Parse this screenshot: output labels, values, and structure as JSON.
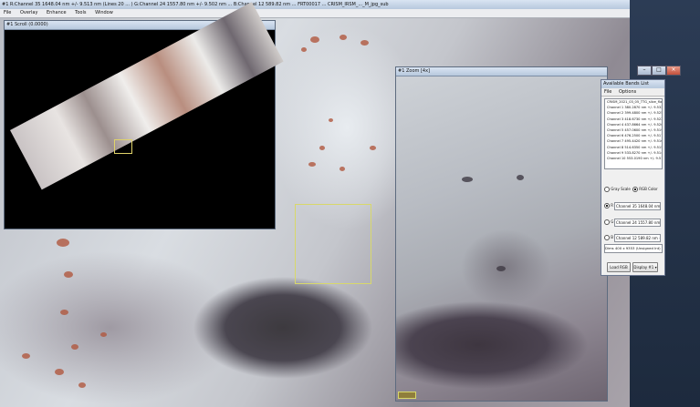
{
  "main_window": {
    "title": "#1 R:Channel 35 1648.04 nm +/- 9.513 nm (Lines 20 ... ) G:Channel 24 1557.80 nm +/- 9.502 nm ... B:Channel 12 589.82 nm ... FRT00017 ... CRISM_IRSM_..._M_jpg_sub",
    "menu": [
      "File",
      "Overlay",
      "Enhance",
      "Tools",
      "Window"
    ]
  },
  "scroll_window": {
    "title": "#1 Scroll (0.0000)"
  },
  "zoom_window": {
    "title": "#1 Zoom [4x]"
  },
  "bands_window": {
    "title": "Available Bands List",
    "menu": [
      "File",
      "Options"
    ],
    "file_name": "CRISM_2021_03_05_TTG_slice_flat.sli",
    "bands": [
      "Channel 1 380.2870 nm +/- 9.532nm",
      "Channel 2 399.4800 nm +/- 9.525nm",
      "Channel 3 418.6730 nm +/- 9.522nm",
      "Channel 4 437.8664 nm +/- 9.520nm",
      "Channel 5 457.0600 nm +/- 9.519nm",
      "Channel 6 476.2500 nm +/- 9.517nm",
      "Channel 7 495.4420 nm +/- 9.516nm",
      "Channel 8 514.6350 nm +/- 9.515nm",
      "Channel 9 533.8270 nm +/- 9.514nm",
      "Channel 10 553.0190 nm +/- 9.513nm"
    ],
    "gray_scale_label": "Gray Scale",
    "rgb_color_label": "RGB Color",
    "r_label": "R",
    "g_label": "G",
    "b_label": "B",
    "r_value": "Channel 35 1648.04 nm +/- 9.513 n",
    "g_value": "Channel 24 1557.80 nm +/- 9.502 n",
    "b_value": "Channel 12 589.82 nm +/- 9.502 n",
    "dims": "Dims 400 x 9353 (Unsigned Int) [BSP]",
    "load_rgb_label": "Load RGB",
    "display_label": "Display #1 ▾"
  }
}
